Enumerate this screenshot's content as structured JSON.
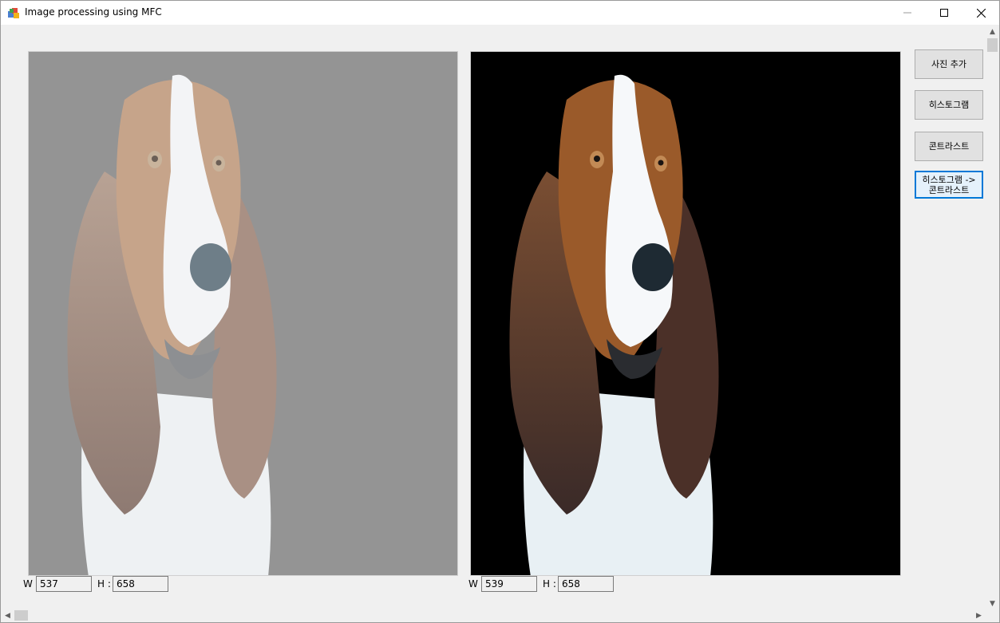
{
  "window": {
    "title": "Image processing using MFC",
    "icon": "mfc-app-icon",
    "controls": {
      "minimize": "minimize-icon",
      "maximize": "maximize-icon",
      "close": "close-icon"
    }
  },
  "left_image": {
    "description": "basset-hound-low-contrast",
    "background": "#949494",
    "width_label": "W",
    "width_value": "537",
    "height_label": "H :",
    "height_value": "658"
  },
  "right_image": {
    "description": "basset-hound-contrast-stretched",
    "background": "#000000",
    "width_label": "W",
    "width_value": "539",
    "height_label": "H :",
    "height_value": "658"
  },
  "buttons": {
    "add_photo": "사진 추가",
    "histogram": "히스토그램",
    "contrast": "콘트라스트",
    "hist_to_contrast_line1": "히스토그램 ->",
    "hist_to_contrast_line2": "콘트라스트"
  },
  "colors": {
    "focus_accent": "#0078d7",
    "button_face": "#e1e1e1"
  }
}
